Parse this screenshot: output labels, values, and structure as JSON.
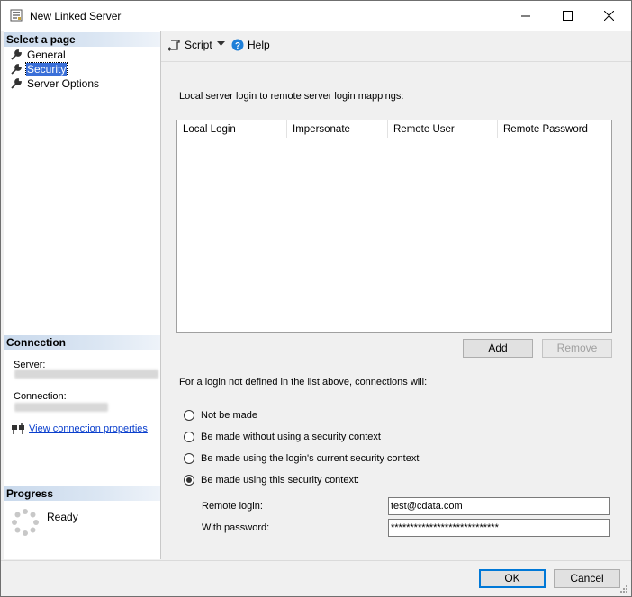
{
  "window": {
    "title": "New Linked Server",
    "minimize_icon": "minimize-icon",
    "maximize_icon": "maximize-icon",
    "close_icon": "close-icon"
  },
  "sidebar": {
    "select_page_header": "Select a page",
    "pages": [
      {
        "label": "General",
        "icon": "wrench-icon",
        "selected": false
      },
      {
        "label": "Security",
        "icon": "wrench-icon",
        "selected": true
      },
      {
        "label": "Server Options",
        "icon": "wrench-icon",
        "selected": false
      }
    ],
    "connection_header": "Connection",
    "server_label": "Server:",
    "connection_label": "Connection:",
    "view_connection_properties": "View connection properties",
    "progress_header": "Progress",
    "progress_status": "Ready"
  },
  "toolbar": {
    "script_label": "Script",
    "help_label": "Help"
  },
  "security": {
    "mappings_title": "Local server login to remote server login mappings:",
    "columns": [
      "Local Login",
      "Impersonate",
      "Remote User",
      "Remote Password"
    ],
    "add_label": "Add",
    "remove_label": "Remove",
    "connections_note": "For a login not defined in the list above, connections will:",
    "options": [
      {
        "label": "Not be made",
        "checked": false
      },
      {
        "label": "Be made without using a security context",
        "checked": false
      },
      {
        "label": "Be made using the login's current security context",
        "checked": false
      },
      {
        "label": "Be made using this security context:",
        "checked": true
      }
    ],
    "remote_login_label": "Remote login:",
    "remote_login_value": "test@cdata.com",
    "password_label": "With password:",
    "password_value": "****************************"
  },
  "footer": {
    "ok_label": "OK",
    "cancel_label": "Cancel"
  }
}
